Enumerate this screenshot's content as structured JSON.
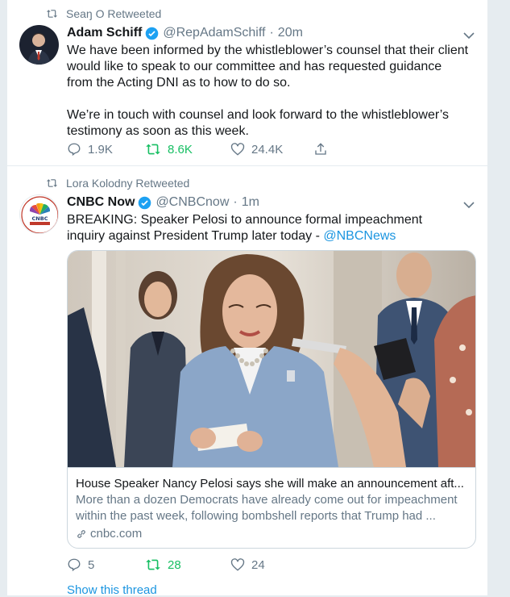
{
  "tweets": [
    {
      "retweeted_by": "Seaŋ O Retweeted",
      "name": "Adam Schiff",
      "handle": "@RepAdamSchiff",
      "dot": "·",
      "time": "20m",
      "text_p1": "We have been informed by the whistleblower’s counsel that their client would like to speak to our committee and has requested guidance from the Acting DNI as to how to do so.",
      "text_p2": "We’re in touch with counsel and look forward to the whistleblower’s testimony as soon as this week.",
      "replies": "1.9K",
      "retweets": "8.6K",
      "likes": "24.4K"
    },
    {
      "retweeted_by": "Lora Kolodny Retweeted",
      "name": "CNBC Now",
      "handle": "@CNBCnow",
      "dot": "·",
      "time": "1m",
      "text": "BREAKING: Speaker Pelosi to announce formal impeachment inquiry against President Trump later today - ",
      "mention": "@NBCNews",
      "card": {
        "title": "House Speaker Nancy Pelosi says she will make an announcement aft...",
        "description": "More than a dozen Democrats have already come out for impeachment within the past week, following bombshell reports that Trump had ...",
        "domain": "cnbc.com"
      },
      "replies": "5",
      "retweets": "28",
      "likes": "24",
      "show_thread": "Show this thread"
    }
  ],
  "colors": {
    "accent": "#1b95e0",
    "retweet_green": "#17bf63",
    "secondary_text": "#657786",
    "verified": "#1da1f2"
  },
  "icons": {
    "retweet": "retweet-icon",
    "verified": "verified-badge-icon",
    "reply": "reply-icon",
    "like": "heart-icon",
    "share": "share-icon",
    "chevron": "chevron-down-icon",
    "link": "link-icon"
  }
}
